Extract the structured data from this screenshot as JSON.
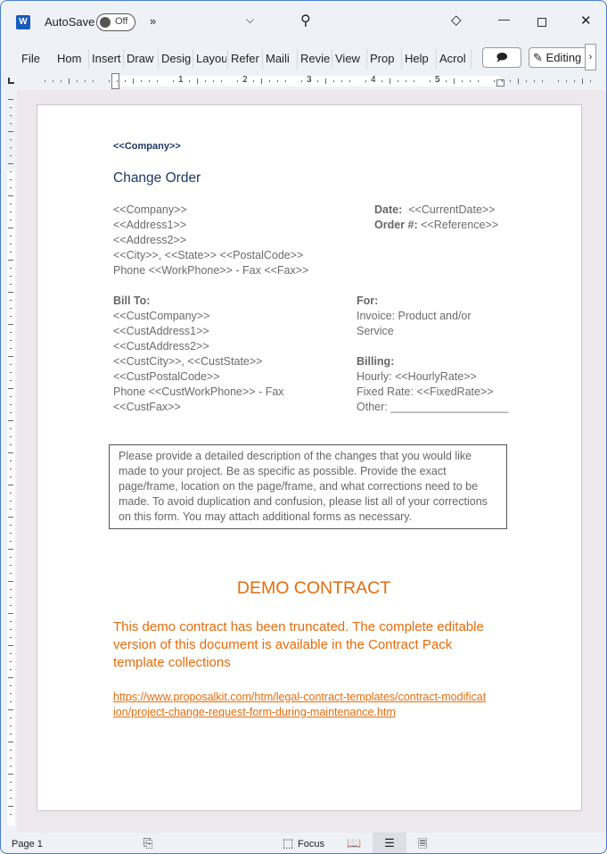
{
  "titlebar": {
    "autosave_label": "AutoSave",
    "autosave_state": "Off",
    "more": "»"
  },
  "ribbon": {
    "tabs": [
      "File",
      "Home",
      "Insert",
      "Draw",
      "Design",
      "Layout",
      "References",
      "Mailings",
      "Review",
      "View",
      "Properties",
      "Help",
      "Acrobat"
    ],
    "tabs_visible": [
      "File",
      "Hom",
      "Insert",
      "Draw",
      "Desig",
      "Layou",
      "Refer",
      "Maili",
      "Revie",
      "View",
      "Prop",
      "Help",
      "Acrol"
    ],
    "editing_label": "Editing"
  },
  "ruler": {
    "labels": [
      "1",
      "2",
      "3",
      "4",
      "5"
    ]
  },
  "doc": {
    "company_header": "<<Company>>",
    "title": "Change Order",
    "sender": [
      "<<Company>>",
      "<<Address1>>",
      "<<Address2>>",
      "<<City>>, <<State>>  <<PostalCode>>",
      "Phone <<WorkPhone>>  - Fax <<Fax>>"
    ],
    "date_label": "Date:",
    "date_value": "<<CurrentDate>>",
    "order_label": "Order #:",
    "order_value": "<<Reference>>",
    "billto_label": "Bill To:",
    "billto": [
      "<<CustCompany>>",
      "<<CustAddress1>>",
      "<<CustAddress2>>",
      "<<CustCity>>, <<CustState>>",
      "<<CustPostalCode>>",
      "Phone <<CustWorkPhone>>  - Fax",
      "<<CustFax>>"
    ],
    "for_label": "For:",
    "for_lines": [
      "Invoice: Product and/or",
      "Service"
    ],
    "billing_label": "Billing:",
    "billing": [
      "Hourly: <<HourlyRate>>",
      "Fixed Rate: <<FixedRate>>",
      "Other: ___________________"
    ],
    "instructions": "Please provide a detailed description of the changes that you would like made to your project.  Be as specific as possible.  Provide the exact page/frame, location on the page/frame, and what corrections need to be made.  To avoid duplication and confusion, please list all of your corrections on this form.  You may attach additional forms as necessary.",
    "demo_title": "DEMO CONTRACT",
    "demo_text": "This demo contract has been truncated. The complete editable version of this document is available in the Contract Pack template collections",
    "link": "https://www.proposalkit.com/htm/legal-contract-templates/contract-modification/project-change-request-form-during-maintenance.htm"
  },
  "status": {
    "page": "Page 1",
    "focus": "Focus"
  },
  "colors": {
    "accent_orange": "#e46c0a",
    "title_navy": "#1f3864",
    "word_blue": "#185abd"
  }
}
